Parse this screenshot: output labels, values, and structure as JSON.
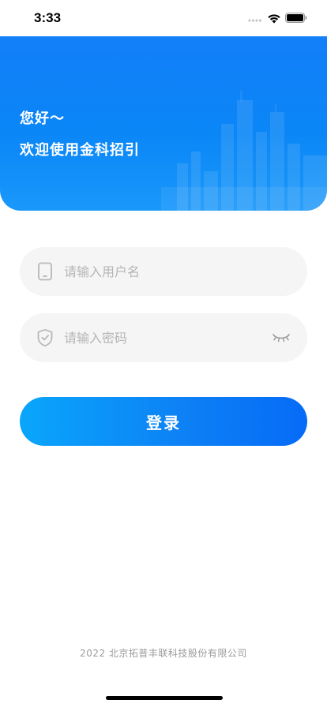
{
  "status_bar": {
    "time": "3:33"
  },
  "header": {
    "greeting": "您好～",
    "welcome": "欢迎使用金科招引"
  },
  "login_form": {
    "username_placeholder": "请输入用户名",
    "password_placeholder": "请输入密码",
    "username_icon": "phone-icon",
    "password_icon": "shield-check-icon",
    "toggle_icon": "eye-closed-icon",
    "login_label": "登录"
  },
  "footer": {
    "copyright": "2022 北京拓普丰联科技股份有限公司"
  },
  "colors": {
    "header_blue": "#0a86f7",
    "button_start": "#0aa6fb",
    "button_end": "#066bf7",
    "field_bg": "#f5f5f5",
    "placeholder": "#b5b5b5"
  }
}
